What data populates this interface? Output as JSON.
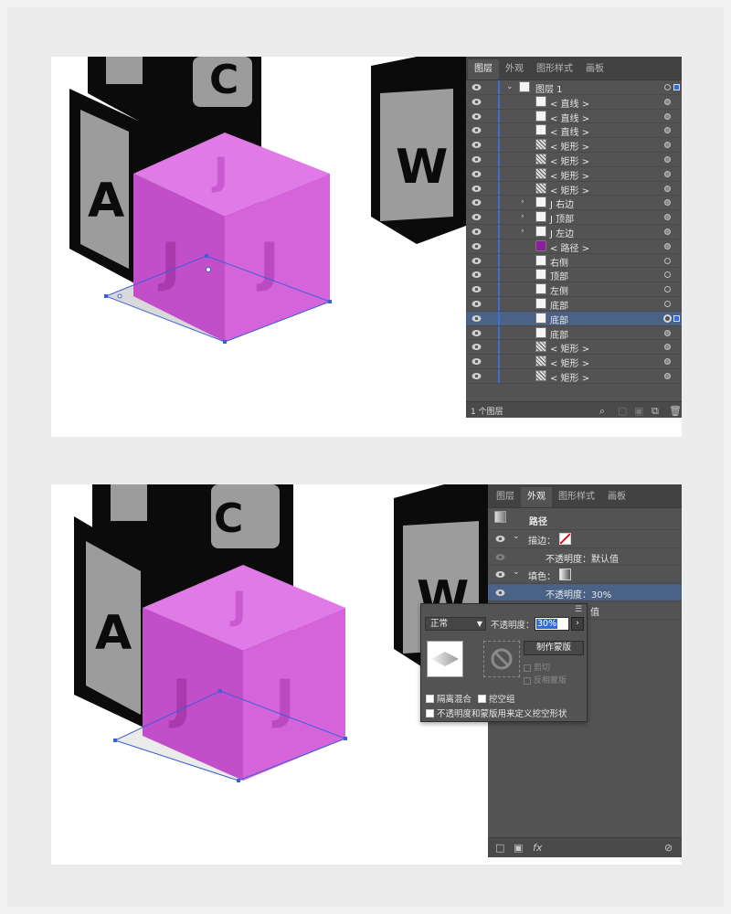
{
  "layers_panel": {
    "tabs": [
      "图层",
      "外观",
      "图形样式",
      "画板"
    ],
    "active_tab": "图层",
    "layer_name": "图层 1",
    "items": [
      {
        "name": "< 直线 >",
        "thumb": "white",
        "expander": ""
      },
      {
        "name": "< 直线 >",
        "thumb": "white",
        "expander": ""
      },
      {
        "name": "< 直线 >",
        "thumb": "white",
        "expander": ""
      },
      {
        "name": "< 矩形 >",
        "thumb": "hatched",
        "expander": ""
      },
      {
        "name": "< 矩形 >",
        "thumb": "hatched",
        "expander": ""
      },
      {
        "name": "< 矩形 >",
        "thumb": "hatched",
        "expander": ""
      },
      {
        "name": "< 矩形 >",
        "thumb": "hatched",
        "expander": ""
      },
      {
        "name": "J 右边",
        "thumb": "white",
        "expander": "›"
      },
      {
        "name": "J 顶部",
        "thumb": "white",
        "expander": "›"
      },
      {
        "name": "J 左边",
        "thumb": "white",
        "expander": "›"
      },
      {
        "name": "< 路径 >",
        "thumb": "purple",
        "expander": ""
      },
      {
        "name": "右侧",
        "thumb": "white",
        "expander": ""
      },
      {
        "name": "顶部",
        "thumb": "white",
        "expander": ""
      },
      {
        "name": "左侧",
        "thumb": "white",
        "expander": ""
      },
      {
        "name": "底部",
        "thumb": "white",
        "expander": ""
      },
      {
        "name": "底部",
        "thumb": "white",
        "expander": "",
        "selected": true
      },
      {
        "name": "底部",
        "thumb": "white",
        "expander": ""
      },
      {
        "name": "< 矩形 >",
        "thumb": "hatched",
        "expander": ""
      },
      {
        "name": "< 矩形 >",
        "thumb": "hatched",
        "expander": ""
      },
      {
        "name": "< 矩形 >",
        "thumb": "hatched",
        "expander": ""
      }
    ],
    "footer_count": "1 个图层"
  },
  "appearance_panel": {
    "tabs": [
      "图层",
      "外观",
      "图形样式",
      "画板"
    ],
    "active_tab": "外观",
    "object_label": "路径",
    "stroke_label": "描边：",
    "stroke_opacity": "不透明度：默认值",
    "fill_label": "填色：",
    "fill_opacity": "不透明度：30%",
    "hidden_row": "值"
  },
  "transparency_popup": {
    "blend_mode": "正常",
    "opacity_label": "不透明度：",
    "opacity_value": "30%",
    "make_mask_button": "制作蒙版",
    "clip_label": "剪切",
    "invert_mask_label": "反相蒙版",
    "isolate_blending": "隔离混合",
    "knockout_group": "挖空组",
    "opacity_mask_knockout": "不透明度和蒙版用来定义挖空形状"
  },
  "artwork": {
    "block_letters": [
      "A",
      "C",
      "W",
      "J"
    ],
    "cube_color": "#c953d0",
    "cube_top_color": "#e07ae6",
    "block_dark": "#0b0b0b",
    "block_face": "#9c9c9c"
  },
  "colors": {
    "panel_bg": "#535353",
    "tab_bar": "#424242",
    "selection": "#4a6286",
    "layer_bar": "#3b6fd6"
  }
}
